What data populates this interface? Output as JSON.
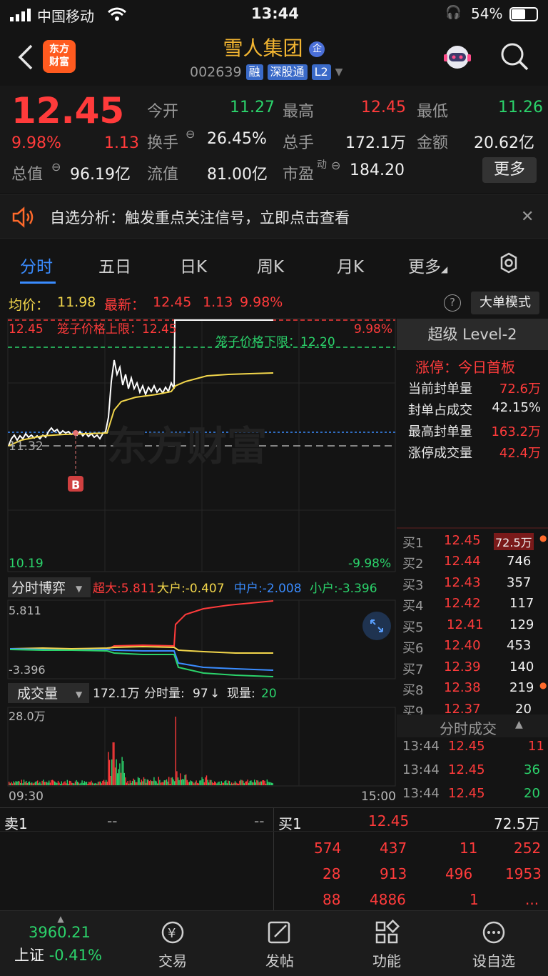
{
  "status": {
    "carrier": "中国移动",
    "time": "13:44",
    "battery": "54%"
  },
  "header": {
    "logo_line1": "东方",
    "logo_line2": "财富",
    "title": "雪人集团",
    "title_badge": "企",
    "code": "002639",
    "tags": [
      "融",
      "深股通",
      "L2"
    ]
  },
  "quote": {
    "price": "12.45",
    "change_pct": "9.98%",
    "change": "1.13",
    "open_label": "今开",
    "open": "11.27",
    "high_label": "最高",
    "high": "12.45",
    "low_label": "最低",
    "low": "11.26",
    "turnover_label": "换手",
    "turnover": "26.45%",
    "volume_label": "总手",
    "volume": "172.1万",
    "amount_label": "金额",
    "amount": "20.62亿",
    "mktcap_label": "总值",
    "mktcap": "96.19亿",
    "float_label": "流值",
    "float": "81.00亿",
    "pe_label": "市盈",
    "pe_sup": "动",
    "pe": "184.20",
    "more_label": "更多"
  },
  "notice": {
    "text": "自选分析：触发重点关注信号，立即点击查看"
  },
  "tabs": [
    "分时",
    "五日",
    "日K",
    "周K",
    "月K",
    "更多"
  ],
  "avg": {
    "avg_label": "均价：",
    "avg": "11.98",
    "latest_label": "最新：",
    "latest": "12.45",
    "chg": "1.13",
    "pct": "9.98%",
    "mode_btn": "大单模式"
  },
  "chart_top": {
    "top_price": "12.45",
    "upper_limit": "笼子价格上限：12.45",
    "top_pct": "9.98%",
    "lower_limit": "笼子价格下限：12.20",
    "ref_price": "11.32",
    "bottom_price": "10.19",
    "bottom_pct": "-9.98%",
    "watermark": "东方财富",
    "marker": "B"
  },
  "game": {
    "label": "分时博弈",
    "super": "超大:5.811",
    "large": "大户:-0.407",
    "mid": "中户:-2.008",
    "small": "小户:-3.396",
    "ymax": "5.811",
    "ymin": "-3.396"
  },
  "vol": {
    "label": "成交量",
    "total": "172.1万",
    "fs_label": "分时量:",
    "fs": "97",
    "xl_label": "现量:",
    "xl": "20",
    "ymax": "28.0万",
    "t_start": "09:30",
    "t_end": "15:00"
  },
  "level2": {
    "title": "超级 Level-2",
    "limit_up": "涨停：今日首板",
    "rows": [
      {
        "k": "当前封单量",
        "v": "72.6万"
      },
      {
        "k": "封单占成交",
        "v": "42.15%"
      },
      {
        "k": "最高封单量",
        "v": "163.2万"
      },
      {
        "k": "涨停成交量",
        "v": "42.4万"
      }
    ],
    "bids": [
      {
        "k": "买1",
        "p": "12.45",
        "v": "72.5万"
      },
      {
        "k": "买2",
        "p": "12.44",
        "v": "746"
      },
      {
        "k": "买3",
        "p": "12.43",
        "v": "357"
      },
      {
        "k": "买4",
        "p": "12.42",
        "v": "117"
      },
      {
        "k": "买5",
        "p": "12.41",
        "v": "129"
      },
      {
        "k": "买6",
        "p": "12.40",
        "v": "453"
      },
      {
        "k": "买7",
        "p": "12.39",
        "v": "140"
      },
      {
        "k": "买8",
        "p": "12.38",
        "v": "219"
      },
      {
        "k": "买9",
        "p": "12.37",
        "v": "20"
      }
    ],
    "ticks_title": "分时成交",
    "ticks": [
      {
        "t": "13:44",
        "p": "12.45",
        "v": "11"
      },
      {
        "t": "13:44",
        "p": "12.45",
        "v": "36"
      },
      {
        "t": "13:44",
        "p": "12.45",
        "v": "20"
      }
    ]
  },
  "book": {
    "sell_label": "卖1",
    "sell_p": "--",
    "sell_v": "--",
    "buy_label": "买1",
    "buy_p": "12.45",
    "buy_v": "72.5万",
    "rows": [
      [
        "574",
        "437",
        "11",
        "252"
      ],
      [
        "28",
        "913",
        "496",
        "1953"
      ],
      [
        "88",
        "4886",
        "1",
        "..."
      ]
    ]
  },
  "bottom": {
    "index_value": "3960.21",
    "index_name": "上证",
    "index_pct": "-0.41%",
    "nav": [
      "交易",
      "发帖",
      "功能",
      "设自选"
    ]
  }
}
